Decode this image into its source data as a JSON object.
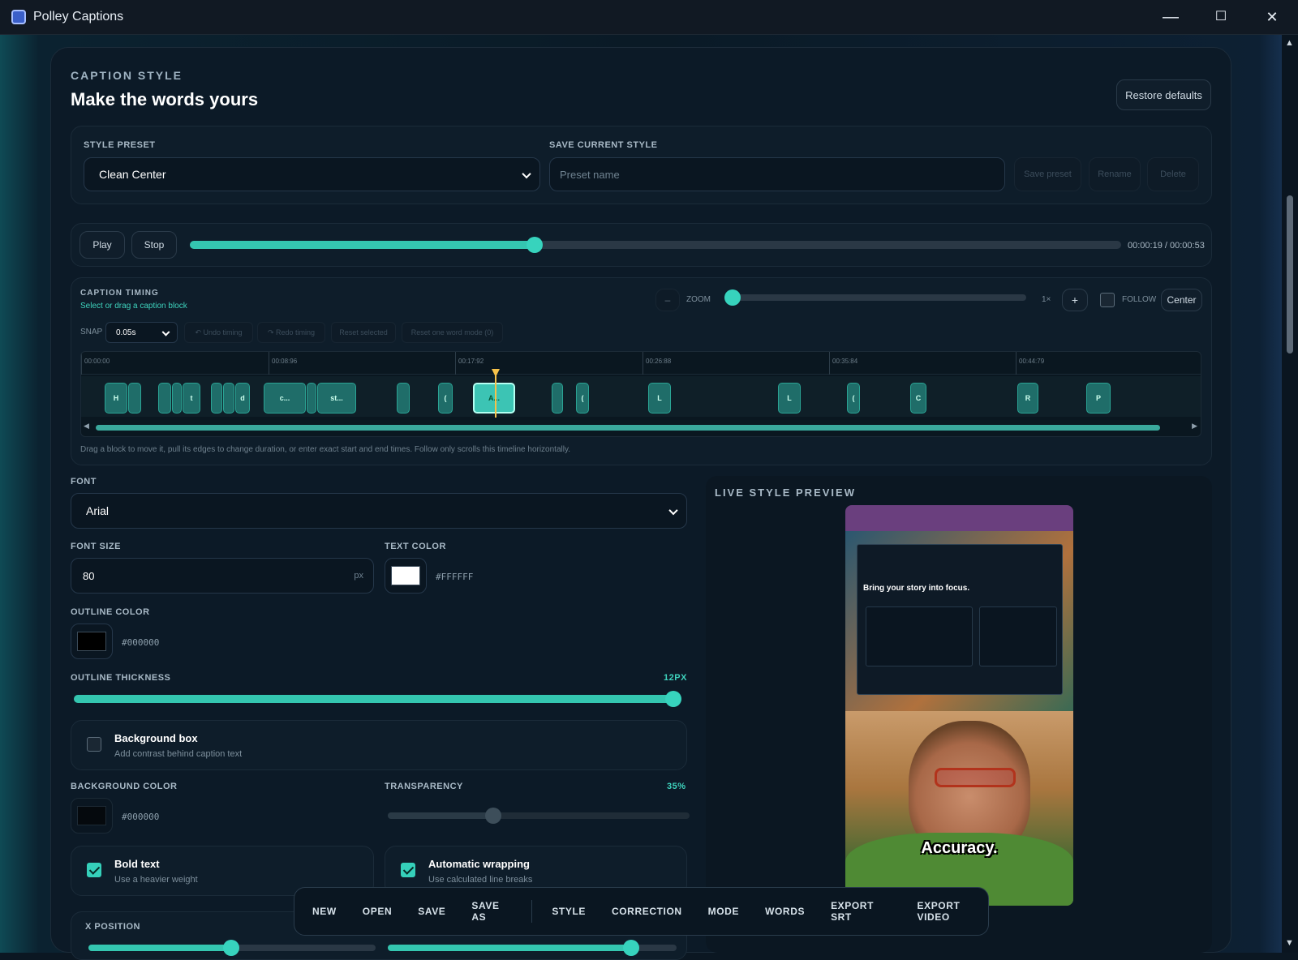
{
  "window": {
    "title": "Polley Captions",
    "minimize": "—",
    "maximize": "☐",
    "close": "✕"
  },
  "section": {
    "eyebrow": "CAPTION STYLE",
    "title": "Make the words yours",
    "restore_label": "Restore defaults"
  },
  "preset": {
    "label": "STYLE PRESET",
    "value": "Clean Center",
    "save_label": "SAVE CURRENT STYLE",
    "name_placeholder": "Preset name",
    "save_btn": "Save preset",
    "rename_btn": "Rename",
    "delete_btn": "Delete"
  },
  "playback": {
    "play": "Play",
    "stop": "Stop",
    "progress": 0.37,
    "time": "00:00:19 / 00:00:53"
  },
  "timing": {
    "title": "CAPTION TIMING",
    "hint": "Select or drag a caption block",
    "zoom_minus": "–",
    "zoom_label": "ZOOM",
    "zoom_level": 0,
    "zoom_value": "1×",
    "zoom_plus": "+",
    "follow_label": "FOLLOW",
    "center_btn": "Center",
    "snap_label": "SNAP",
    "snap_value": "0.05s",
    "undo": "↶ Undo timing",
    "redo": "↷ Redo timing",
    "reset_selected": "Reset selected",
    "reset_one_word": "Reset one word mode (0)",
    "ticks": [
      "00:00:00",
      "00:08:96",
      "00:17:92",
      "00:26:88",
      "00:35:84",
      "00:44:79"
    ],
    "blocks": [
      "H",
      "",
      "",
      "t",
      "",
      "",
      "d",
      "c...",
      "",
      "st...",
      "",
      "(",
      "A...",
      "",
      "(",
      "L",
      "L",
      "(",
      "C",
      "R",
      "P"
    ],
    "note": "Drag a block to move it, pull its edges to change duration, or enter exact start and end times. Follow only scrolls this timeline horizontally."
  },
  "font": {
    "label": "FONT",
    "value": "Arial",
    "size_label": "FONT SIZE",
    "size_value": "80",
    "size_unit": "px",
    "text_color_label": "TEXT COLOR",
    "text_color": "#FFFFFF",
    "outline_color_label": "OUTLINE COLOR",
    "outline_color": "#000000",
    "outline_thickness_label": "OUTLINE THICKNESS",
    "outline_thickness_value": "12PX",
    "outline_thickness_level": 1.0
  },
  "background": {
    "title": "Background box",
    "sub": "Add contrast behind caption text",
    "checked": false,
    "color_label": "BACKGROUND COLOR",
    "color": "#000000",
    "transparency_label": "TRANSPARENCY",
    "transparency_value": "35%",
    "transparency_level": 0.35
  },
  "bold": {
    "title": "Bold text",
    "sub": "Use a heavier weight",
    "checked": true
  },
  "wrap": {
    "title": "Automatic wrapping",
    "sub": "Use calculated line breaks",
    "checked": true
  },
  "position": {
    "x_label": "X POSITION"
  },
  "preview": {
    "label": "LIVE STYLE PREVIEW",
    "screen_headline": "Bring your story into focus.",
    "caption": "Accuracy."
  },
  "menu": {
    "items": [
      "NEW",
      "OPEN",
      "SAVE",
      "SAVE AS"
    ],
    "items2": [
      "STYLE",
      "CORRECTION",
      "MODE",
      "WORDS",
      "EXPORT SRT",
      "EXPORT VIDEO"
    ]
  },
  "colors": {
    "accent": "#35D0BA",
    "panel": "#0C1A27",
    "playhead": "#F6C24A"
  }
}
